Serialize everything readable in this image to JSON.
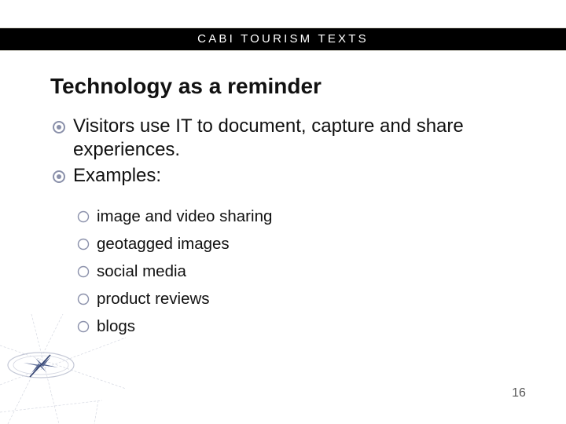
{
  "header": {
    "title": "CABI TOURISM TEXTS"
  },
  "slide": {
    "title": "Technology as a reminder",
    "bullets": [
      {
        "icon": "circled-dot-icon",
        "text": "Visitors use IT to document, capture and share experiences."
      },
      {
        "icon": "circled-dot-icon",
        "text": "Examples:"
      }
    ],
    "sub_bullets": [
      {
        "icon": "hollow-circle-icon",
        "text": "image and video sharing"
      },
      {
        "icon": "hollow-circle-icon",
        "text": "geotagged images"
      },
      {
        "icon": "hollow-circle-icon",
        "text": "social media"
      },
      {
        "icon": "hollow-circle-icon",
        "text": "product reviews"
      },
      {
        "icon": "hollow-circle-icon",
        "text": "blogs"
      }
    ],
    "page_number": "16"
  },
  "colors": {
    "header_bg": "#000000",
    "header_text": "#ffffff",
    "bullet_marker": "#8a90aa",
    "compass_accent": "#2f3f6e"
  }
}
